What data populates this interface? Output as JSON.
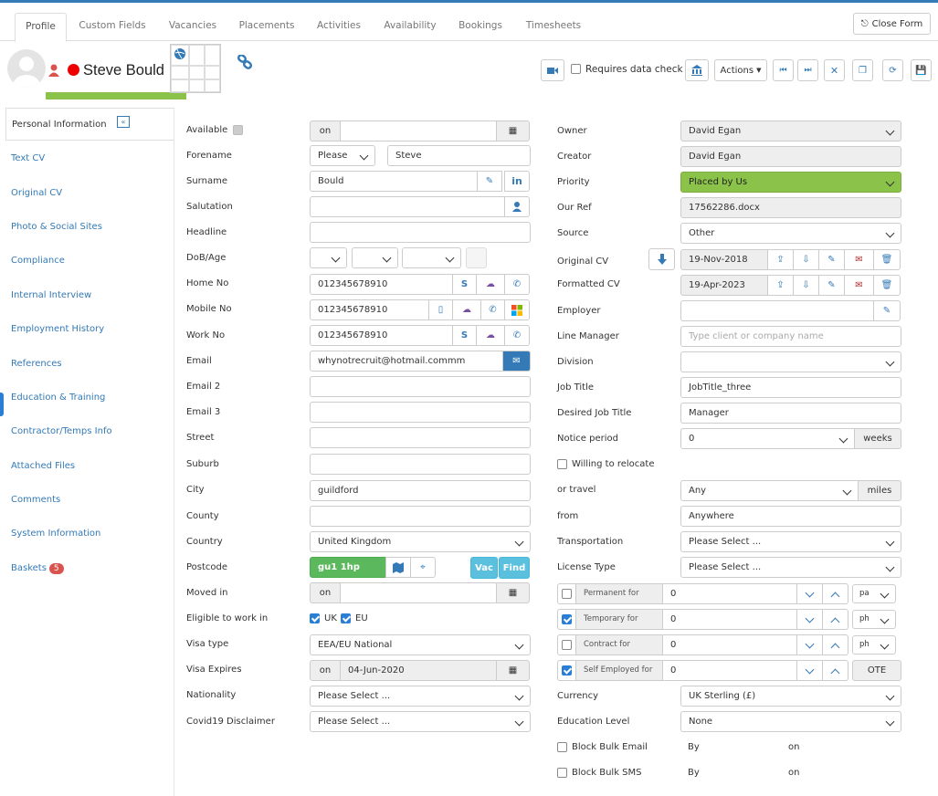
{
  "tabs": [
    "Profile",
    "Custom Fields",
    "Vacancies",
    "Placements",
    "Activities",
    "Availability",
    "Bookings",
    "Timesheets"
  ],
  "close_form": "Close Form",
  "candidate_name": "Steve Bould",
  "requires_data_check": "Requires data check",
  "actions_label": "Actions",
  "sidebar": {
    "active": "Personal Information",
    "items": [
      "Text CV",
      "Original CV",
      "Photo & Social Sites",
      "Compliance",
      "Internal Interview",
      "Employment History",
      "References",
      "Education & Training",
      "Contractor/Temps Info",
      "Attached Files",
      "Comments",
      "System Information",
      "Baskets"
    ],
    "baskets_count": "5"
  },
  "left": {
    "available": "Available",
    "available_on": "on",
    "forename": "Forename",
    "title_select": "Please",
    "forename_value": "Steve",
    "surname": "Surname",
    "surname_value": "Bould",
    "salutation": "Salutation",
    "headline": "Headline",
    "dob": "DoB/Age",
    "home_no": "Home No",
    "home_value": "012345678910",
    "mobile_no": "Mobile No",
    "mobile_value": "012345678910",
    "work_no": "Work No",
    "work_value": "012345678910",
    "email": "Email",
    "email_value": "whynotrecruit@hotmail.commm",
    "email2": "Email 2",
    "email3": "Email 3",
    "street": "Street",
    "suburb": "Suburb",
    "city": "City",
    "city_value": "guildford",
    "county": "County",
    "country": "Country",
    "country_value": "United Kingdom",
    "postcode": "Postcode",
    "postcode_value": "gu1 1hp",
    "vac": "Vac",
    "find": "Find",
    "moved_in": "Moved in",
    "moved_on": "on",
    "eligible": "Eligible to work in",
    "uk": "UK",
    "eu": "EU",
    "visa_type": "Visa type",
    "visa_type_value": "EEA/EU National",
    "visa_expires": "Visa Expires",
    "visa_on": "on",
    "visa_date": "04-Jun-2020",
    "nationality": "Nationality",
    "nationality_value": "Please Select ...",
    "covid": "Covid19 Disclaimer",
    "covid_value": "Please Select ..."
  },
  "right": {
    "owner": "Owner",
    "owner_value": "David Egan",
    "creator": "Creator",
    "creator_value": "David Egan",
    "priority": "Priority",
    "priority_value": "Placed by Us",
    "our_ref": "Our Ref",
    "our_ref_value": "17562286.docx",
    "source": "Source",
    "source_value": "Other",
    "original_cv": "Original CV",
    "original_cv_date": "19-Nov-2018",
    "formatted_cv": "Formatted CV",
    "formatted_cv_date": "19-Apr-2023",
    "employer": "Employer",
    "line_manager": "Line Manager",
    "line_manager_ph": "Type client or company name",
    "division": "Division",
    "job_title": "Job Title",
    "job_title_value": "JobTitle_three",
    "desired_job_title": "Desired Job Title",
    "desired_value": "Manager",
    "notice": "Notice period",
    "notice_value": "0",
    "weeks": "weeks",
    "relocate": "Willing to relocate",
    "or_travel": "or travel",
    "travel_value": "Any",
    "miles": "miles",
    "from": "from",
    "from_value": "Anywhere",
    "transportation": "Transportation",
    "transport_value": "Please Select ...",
    "license": "License Type",
    "license_value": "Please Select ...",
    "permanent": "Permanent for",
    "perm_value": "0",
    "perm_unit": "pa",
    "temporary": "Temporary for",
    "temp_value": "0",
    "temp_unit": "ph",
    "contract": "Contract for",
    "contract_value": "0",
    "contract_unit": "ph",
    "self_employed": "Self Employed for",
    "self_value": "0",
    "ote": "OTE",
    "currency": "Currency",
    "currency_value": "UK Sterling (£)",
    "education": "Education Level",
    "education_value": "None",
    "block_email": "Block Bulk Email",
    "block_sms": "Block Bulk SMS",
    "by": "By",
    "on": "on"
  }
}
